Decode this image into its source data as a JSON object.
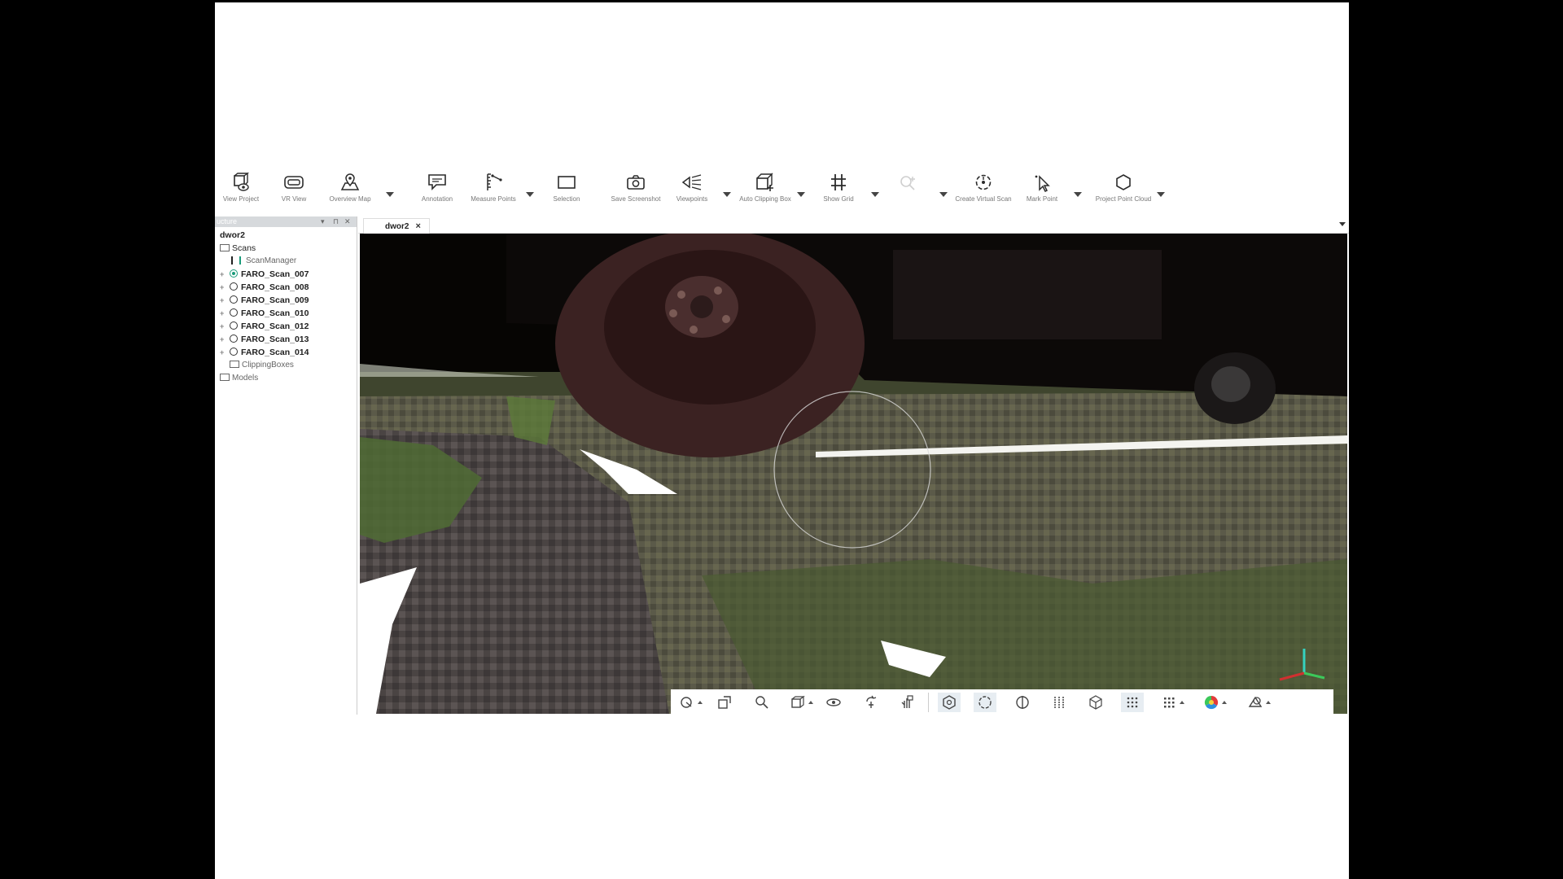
{
  "ribbon": {
    "items": [
      {
        "label": "View Project",
        "icon": "view-project-icon"
      },
      {
        "label": "VR View",
        "icon": "vr-headset-icon"
      },
      {
        "label": "Overview Map",
        "icon": "map-pin-icon"
      },
      {
        "label": "Annotation",
        "icon": "annotation-icon"
      },
      {
        "label": "Measure Points",
        "icon": "measure-icon"
      },
      {
        "label": "Selection",
        "icon": "selection-rect-icon"
      },
      {
        "label": "Save Screenshot",
        "icon": "camera-icon"
      },
      {
        "label": "Viewpoints",
        "icon": "viewpoints-icon"
      },
      {
        "label": "Auto Clipping Box",
        "icon": "clipping-box-icon"
      },
      {
        "label": "Show Grid",
        "icon": "grid-icon"
      },
      {
        "label": "",
        "icon": "search-add-icon",
        "disabled": true
      },
      {
        "label": "Create Virtual Scan",
        "icon": "virtual-scan-icon"
      },
      {
        "label": "Mark Point",
        "icon": "mark-point-icon"
      },
      {
        "label": "Project Point Cloud",
        "icon": "point-cloud-icon"
      }
    ]
  },
  "panel": {
    "title": "ucture",
    "tree": [
      {
        "label": "dwor2",
        "level": 0,
        "type": "root"
      },
      {
        "label": "Scans",
        "level": 0,
        "type": "folder-expanded"
      },
      {
        "label": "ScanManager",
        "level": 1,
        "type": "manager"
      },
      {
        "label": "FARO_Scan_007",
        "level": 1,
        "type": "scan",
        "active": true
      },
      {
        "label": "FARO_Scan_008",
        "level": 1,
        "type": "scan"
      },
      {
        "label": "FARO_Scan_009",
        "level": 1,
        "type": "scan"
      },
      {
        "label": "FARO_Scan_010",
        "level": 1,
        "type": "scan"
      },
      {
        "label": "FARO_Scan_012",
        "level": 1,
        "type": "scan"
      },
      {
        "label": "FARO_Scan_013",
        "level": 1,
        "type": "scan"
      },
      {
        "label": "FARO_Scan_014",
        "level": 1,
        "type": "scan"
      },
      {
        "label": "ClippingBoxes",
        "level": 1,
        "type": "folder"
      },
      {
        "label": "Models",
        "level": 0,
        "type": "folder"
      }
    ]
  },
  "tabs": [
    {
      "label": "dwor2",
      "close": "×"
    }
  ],
  "bottom_toolbar": {
    "tools": [
      "navigation-mode-icon",
      "fit-view-icon",
      "zoom-icon",
      "view-cube-icon",
      "orbit-icon",
      "walk-icon",
      "pan-icon",
      "scan-view-icon",
      "sphere-view-icon",
      "split-view-icon",
      "slice-icon",
      "box-icon",
      "point-grid-icon",
      "point-density-icon",
      "color-mode-icon",
      "layer-style-icon"
    ],
    "active": [
      "scan-view-icon",
      "sphere-view-icon",
      "point-grid-icon"
    ]
  },
  "colors": {
    "accent": "#1a9b7a",
    "viewport_bg": "#050402"
  }
}
